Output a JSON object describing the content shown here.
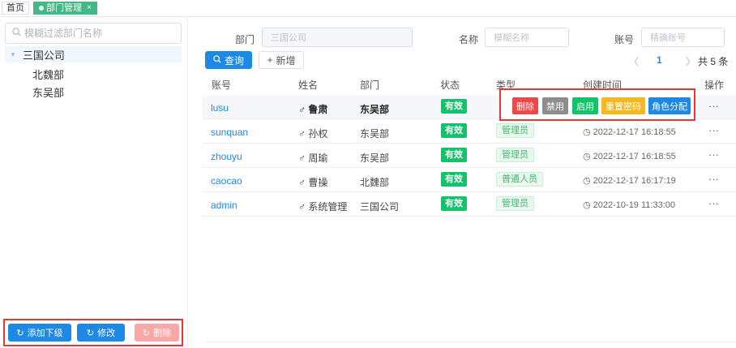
{
  "tabs": {
    "home": "首页",
    "active": "部门管理",
    "close": "×"
  },
  "tree": {
    "filter_placeholder": "模糊过滤部门名称",
    "root": "三国公司",
    "children": [
      "北魏部",
      "东吴部"
    ]
  },
  "left_actions": {
    "add_child": "添加下级",
    "edit": "修改",
    "delete": "删除"
  },
  "filters": {
    "dept_label": "部门",
    "dept_value": "三国公司",
    "name_label": "名称",
    "name_placeholder": "模糊名称",
    "account_label": "账号",
    "account_placeholder": "精确账号"
  },
  "toolbar": {
    "query": "查询",
    "add": "新增"
  },
  "pager": {
    "prev": "〈",
    "page": "1",
    "next": "〉",
    "total": "共 5 条"
  },
  "table": {
    "headers": [
      "账号",
      "姓名",
      "部门",
      "状态",
      "类型",
      "创建时间",
      "操作"
    ],
    "rows": [
      {
        "account": "lusu",
        "name": "♂ 鲁肃",
        "dept": "东吴部",
        "status": "有效",
        "type": "",
        "time": ""
      },
      {
        "account": "sunquan",
        "name": "♂ 孙权",
        "dept": "东吴部",
        "status": "有效",
        "type": "管理员",
        "time": "2022-12-17 16:18:55"
      },
      {
        "account": "zhouyu",
        "name": "♂ 周瑜",
        "dept": "东吴部",
        "status": "有效",
        "type": "管理员",
        "time": "2022-12-17 16:18:55"
      },
      {
        "account": "caocao",
        "name": "♂ 曹操",
        "dept": "北魏部",
        "status": "有效",
        "type": "普通人员",
        "time": "2022-12-17 16:17:19"
      },
      {
        "account": "admin",
        "name": "♂ 系统管理",
        "dept": "三国公司",
        "status": "有效",
        "type": "管理员",
        "time": "2022-10-19 11:33:00"
      }
    ],
    "more": "···"
  },
  "row_actions": {
    "delete": "删除",
    "disable": "禁用",
    "enable": "启用",
    "reset_password": "重置密码",
    "assign_role": "角色分配"
  }
}
